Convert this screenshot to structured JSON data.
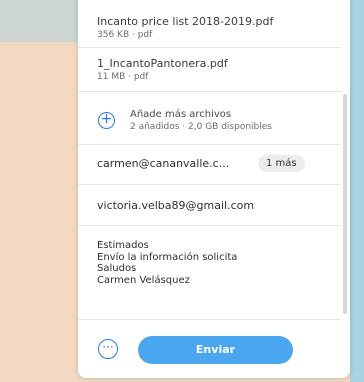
{
  "files": [
    {
      "name": "Incanto price list 2018-2019.pdf",
      "meta": "356 KB · pdf"
    },
    {
      "name": "1_IncantoPantonera.pdf",
      "meta": "11 MB · pdf"
    }
  ],
  "add_files": {
    "icon": "plus-circle-icon",
    "title": "Añade más archivos",
    "subtitle": "2 añadidos · 2,0 GB disponibles"
  },
  "recipients": {
    "to": "carmen@cananvalle.c...",
    "more_chip": "1 más",
    "from": "victoria.velba89@gmail.com"
  },
  "message": {
    "lines": [
      "Estimados",
      "Envío la información solicita",
      "Saludos",
      "Carmen Velásquez"
    ]
  },
  "actions": {
    "more_icon": "ellipsis-icon",
    "send_label": "Enviar"
  },
  "colors": {
    "accent": "#2c7be5",
    "send_button": "#4aa7ef",
    "background_left": "#f3d9c2",
    "background_right": "#a9d3e0"
  }
}
